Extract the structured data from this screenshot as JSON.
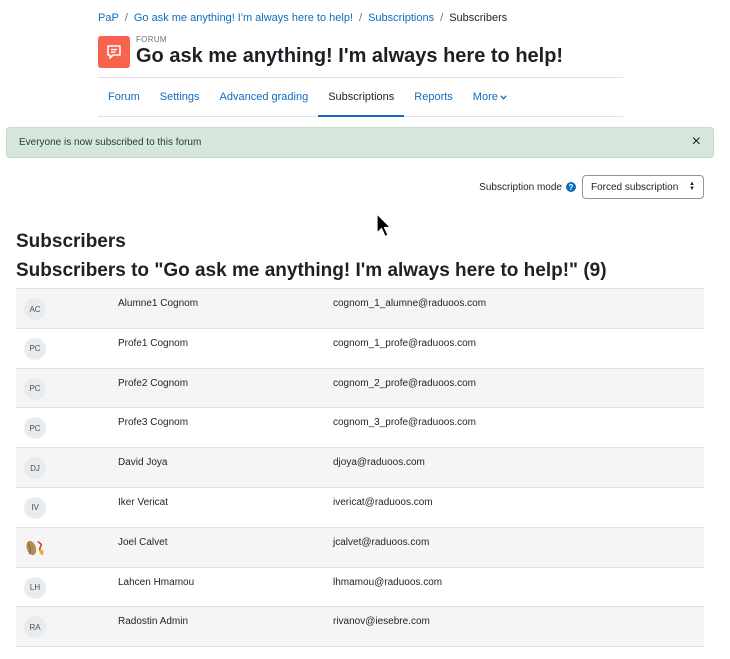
{
  "breadcrumb": [
    "PaP",
    "Go ask me anything! I'm always here to help!",
    "Subscriptions",
    "Subscribers"
  ],
  "header": {
    "kicker": "FORUM",
    "title": "Go ask me anything! I'm always here to help!",
    "icon": "forum-icon"
  },
  "tabs": [
    {
      "label": "Forum"
    },
    {
      "label": "Settings"
    },
    {
      "label": "Advanced grading"
    },
    {
      "label": "Subscriptions",
      "active": true
    },
    {
      "label": "Reports"
    },
    {
      "label": "More"
    }
  ],
  "alert": {
    "text": "Everyone is now subscribed to this forum",
    "close": "×"
  },
  "subscription_mode": {
    "label": "Subscription mode",
    "value": "Forced subscription"
  },
  "headings": {
    "section": "Subscribers",
    "subtitle": "Subscribers to \"Go ask me anything! I'm always here to help!\" (9)"
  },
  "subscribers": [
    {
      "initials": "AC",
      "name": "Alumne1 Cognom",
      "email": "cognom_1_alumne@raduoos.com"
    },
    {
      "initials": "PC",
      "name": "Profe1 Cognom",
      "email": "cognom_1_profe@raduoos.com"
    },
    {
      "initials": "PC",
      "name": "Profe2 Cognom",
      "email": "cognom_2_profe@raduoos.com"
    },
    {
      "initials": "PC",
      "name": "Profe3 Cognom",
      "email": "cognom_3_profe@raduoos.com"
    },
    {
      "initials": "DJ",
      "name": "David Joya",
      "email": "djoya@raduoos.com"
    },
    {
      "initials": "IV",
      "name": "Iker Vericat",
      "email": "ivericat@raduoos.com"
    },
    {
      "initials": "",
      "name": "Joel Calvet",
      "email": "jcalvet@raduoos.com",
      "picture": true
    },
    {
      "initials": "LH",
      "name": "Lahcen Hmamou",
      "email": "lhmamou@raduoos.com"
    },
    {
      "initials": "RA",
      "name": "Radostin Admin",
      "email": "rivanov@iesebre.com"
    }
  ],
  "colors": {
    "accent": "#0f6cbf",
    "forum_icon_bg": "#f7634d",
    "alert_bg": "#d7e6dc"
  }
}
